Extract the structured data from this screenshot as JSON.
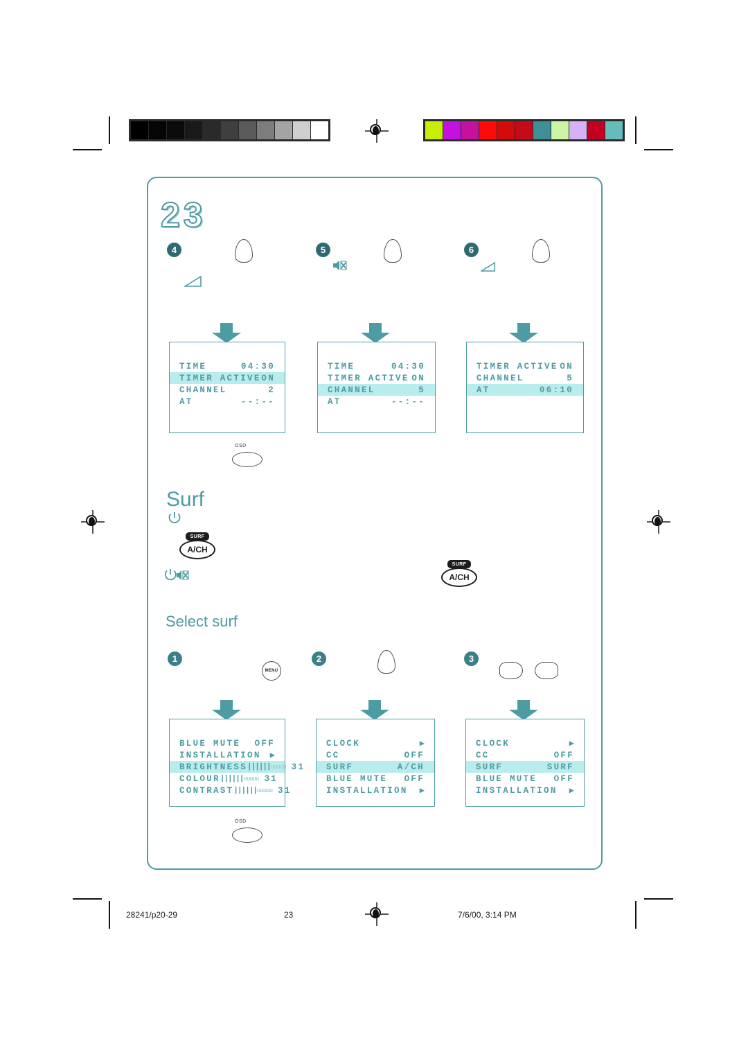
{
  "page": {
    "number_display": "23",
    "frame_color": "#4d9ba3",
    "accent_color": "#4d9ba3",
    "highlight_color": "#b9ecec"
  },
  "headings": {
    "surf": "Surf",
    "select_surf": "Select surf"
  },
  "badges": {
    "four": "4",
    "five": "5",
    "six": "6",
    "one": "1",
    "two": "2",
    "three": "3"
  },
  "buttons": {
    "osd_label": "OSD",
    "menu_label": "MENU",
    "ach_tab": "SURF",
    "ach_label": "A/CH"
  },
  "icons": {
    "volume_wedge": "volume-wedge-icon",
    "mute": "mute-icon",
    "power": "power-icon",
    "power_mute": "power-mute-icon",
    "right_arrow": "▶"
  },
  "osd_top": [
    {
      "name": "timer-panel-1",
      "rows": [
        {
          "label": "TIME",
          "value": "04:30",
          "highlight": false,
          "type": "text"
        },
        {
          "label": "TIMER ACTIVE",
          "value": "ON",
          "highlight": true,
          "type": "text"
        },
        {
          "label": "CHANNEL",
          "value": "2",
          "highlight": false,
          "type": "text"
        },
        {
          "label": "AT",
          "value": "--:--",
          "highlight": false,
          "type": "text"
        }
      ]
    },
    {
      "name": "timer-panel-2",
      "rows": [
        {
          "label": "TIME",
          "value": "04:30",
          "highlight": false,
          "type": "text"
        },
        {
          "label": "TIMER ACTIVE",
          "value": "ON",
          "highlight": false,
          "type": "text"
        },
        {
          "label": "CHANNEL",
          "value": "5",
          "highlight": true,
          "type": "text"
        },
        {
          "label": "AT",
          "value": "--:--",
          "highlight": false,
          "type": "text"
        }
      ]
    },
    {
      "name": "timer-panel-3",
      "rows": [
        {
          "label": "TIMER ACTIVE",
          "value": "ON",
          "highlight": false,
          "type": "text"
        },
        {
          "label": "CHANNEL",
          "value": "5",
          "highlight": false,
          "type": "text"
        },
        {
          "label": "AT",
          "value": "06:10",
          "highlight": true,
          "type": "text"
        }
      ]
    }
  ],
  "osd_bottom": [
    {
      "name": "picture-menu-panel",
      "rows": [
        {
          "label": "BLUE MUTE",
          "value": "OFF",
          "highlight": false,
          "type": "text"
        },
        {
          "label": "INSTALLATION",
          "value": "▶",
          "highlight": false,
          "type": "arrow"
        },
        {
          "label": "BRIGHTNESS",
          "value": "31",
          "highlight": true,
          "type": "gauge"
        },
        {
          "label": "COLOUR",
          "value": "31",
          "highlight": false,
          "type": "gauge"
        },
        {
          "label": "CONTRAST",
          "value": "31",
          "highlight": false,
          "type": "gauge"
        }
      ]
    },
    {
      "name": "features-menu-panel-ach",
      "rows": [
        {
          "label": "CLOCK",
          "value": "▶",
          "highlight": false,
          "type": "arrow"
        },
        {
          "label": "CC",
          "value": "OFF",
          "highlight": false,
          "type": "text"
        },
        {
          "label": "SURF",
          "value": "A/CH",
          "highlight": true,
          "type": "text"
        },
        {
          "label": "BLUE MUTE",
          "value": "OFF",
          "highlight": false,
          "type": "text"
        },
        {
          "label": "INSTALLATION",
          "value": "▶",
          "highlight": false,
          "type": "arrow"
        }
      ]
    },
    {
      "name": "features-menu-panel-surf",
      "rows": [
        {
          "label": "CLOCK",
          "value": "▶",
          "highlight": false,
          "type": "arrow"
        },
        {
          "label": "CC",
          "value": "OFF",
          "highlight": false,
          "type": "text"
        },
        {
          "label": "SURF",
          "value": "SURF",
          "highlight": true,
          "type": "text"
        },
        {
          "label": "BLUE MUTE",
          "value": "OFF",
          "highlight": false,
          "type": "text"
        },
        {
          "label": "INSTALLATION",
          "value": "▶",
          "highlight": false,
          "type": "arrow"
        }
      ]
    }
  ],
  "footer": {
    "job": "28241/p20-29",
    "page_number": "23",
    "timestamp": "7/6/00, 3:14 PM"
  },
  "print_marks": {
    "gray_wedge": [
      "#000000",
      "#050505",
      "#0b0b0b",
      "#191919",
      "#2a2a2a",
      "#3f3f3f",
      "#5a5a5a",
      "#7d7d7d",
      "#a4a4a4",
      "#cfcfcf",
      "#ffffff"
    ],
    "color_patches": [
      "#c6f000",
      "#c511e0",
      "#c4129f",
      "#fb0c09",
      "#d40b0b",
      "#c50a1c",
      "#3e8f98",
      "#cdf5a6",
      "#d7b0f5",
      "#c30022",
      "#65bcbc"
    ]
  }
}
